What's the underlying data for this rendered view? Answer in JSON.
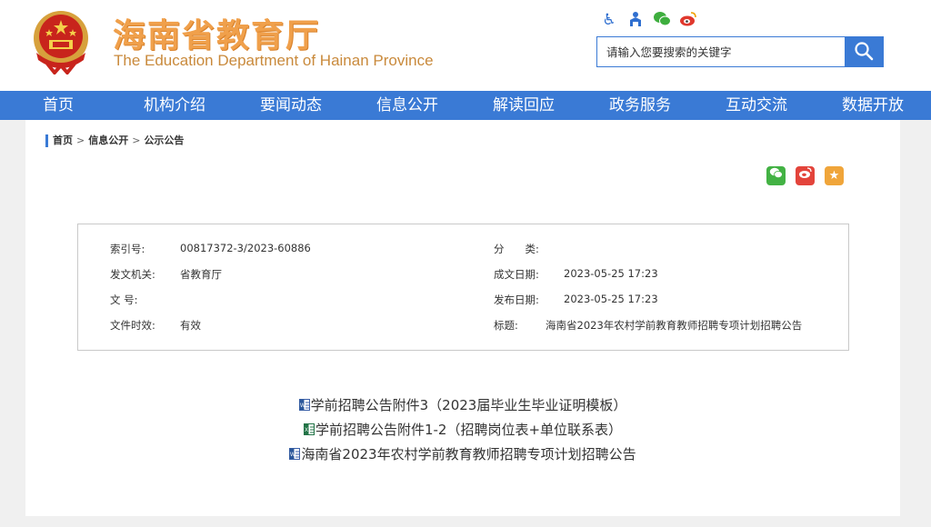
{
  "header": {
    "title_cn": "海南省教育厅",
    "title_en": "The Education Department of Hainan Province",
    "icons": [
      "accessibility-icon",
      "org-icon",
      "wechat-icon",
      "weibo-icon"
    ]
  },
  "search": {
    "placeholder": "请输入您要搜索的关键字",
    "button_icon": "search-icon"
  },
  "nav": {
    "items": [
      "首页",
      "机构介绍",
      "要闻动态",
      "信息公开",
      "解读回应",
      "政务服务",
      "互动交流",
      "数据开放"
    ]
  },
  "breadcrumb": {
    "items": [
      "首页",
      "信息公开",
      "公示公告"
    ],
    "separator": ">"
  },
  "share": {
    "icons": [
      "wechat-share-icon",
      "weibo-share-icon",
      "favorite-icon"
    ]
  },
  "meta": {
    "index_label": "索引号:",
    "index_value": "00817372-3/2023-60886",
    "category_label": "分　　类:",
    "category_value": "",
    "issuer_label": "发文机关:",
    "issuer_value": "省教育厅",
    "created_label": "成文日期:",
    "created_value": "2023-05-25 17:23",
    "docno_label": "文  号:",
    "docno_value": "",
    "published_label": "发布日期:",
    "published_value": "2023-05-25 17:23",
    "validity_label": "文件时效:",
    "validity_value": "有效",
    "subject_label": "标题:",
    "subject_value": "海南省2023年农村学前教育教师招聘专项计划招聘公告"
  },
  "attachments": [
    {
      "label": "学前招聘公告附件3（2023届毕业生毕业证明模板）",
      "icon": "word-doc-icon"
    },
    {
      "label": "学前招聘公告附件1-2（招聘岗位表+单位联系表）",
      "icon": "excel-doc-icon"
    },
    {
      "label": "海南省2023年农村学前教育教师招聘专项计划招聘公告",
      "icon": "word-doc-icon"
    }
  ],
  "colors": {
    "primary": "#3a7ad5",
    "title_orange": "#f0a04b"
  }
}
